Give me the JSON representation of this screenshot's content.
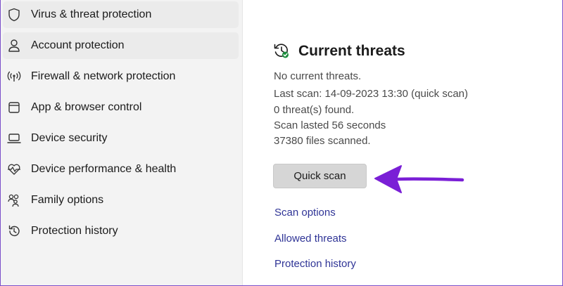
{
  "sidebar": {
    "items": [
      {
        "label": "Virus & threat protection",
        "icon": "shield-icon"
      },
      {
        "label": "Account protection",
        "icon": "person-icon"
      },
      {
        "label": "Firewall & network protection",
        "icon": "antenna-icon"
      },
      {
        "label": "App & browser control",
        "icon": "browser-window-icon"
      },
      {
        "label": "Device security",
        "icon": "laptop-icon"
      },
      {
        "label": "Device performance & health",
        "icon": "heart-pulse-icon"
      },
      {
        "label": "Family options",
        "icon": "family-icon"
      },
      {
        "label": "Protection history",
        "icon": "history-icon"
      }
    ]
  },
  "main": {
    "heading": "Current threats",
    "heading_icon": "clock-check-icon",
    "status": {
      "no_threats": "No current threats.",
      "last_scan": "Last scan: 14-09-2023 13:30 (quick scan)",
      "threats_found": "0 threat(s) found.",
      "duration": "Scan lasted 56 seconds",
      "files_scanned": "37380 files scanned."
    },
    "quick_scan_label": "Quick scan",
    "links": {
      "scan_options": "Scan options",
      "allowed_threats": "Allowed threats",
      "protection_history": "Protection history"
    }
  },
  "annotation": {
    "arrow_color": "#7a1fd6",
    "arrow_icon": "arrow-left-icon"
  },
  "colors": {
    "sidebar_bg": "#f3f3f3",
    "link": "#2f3496",
    "button_bg": "#d6d6d6",
    "frame_border": "#7b4fc9"
  }
}
